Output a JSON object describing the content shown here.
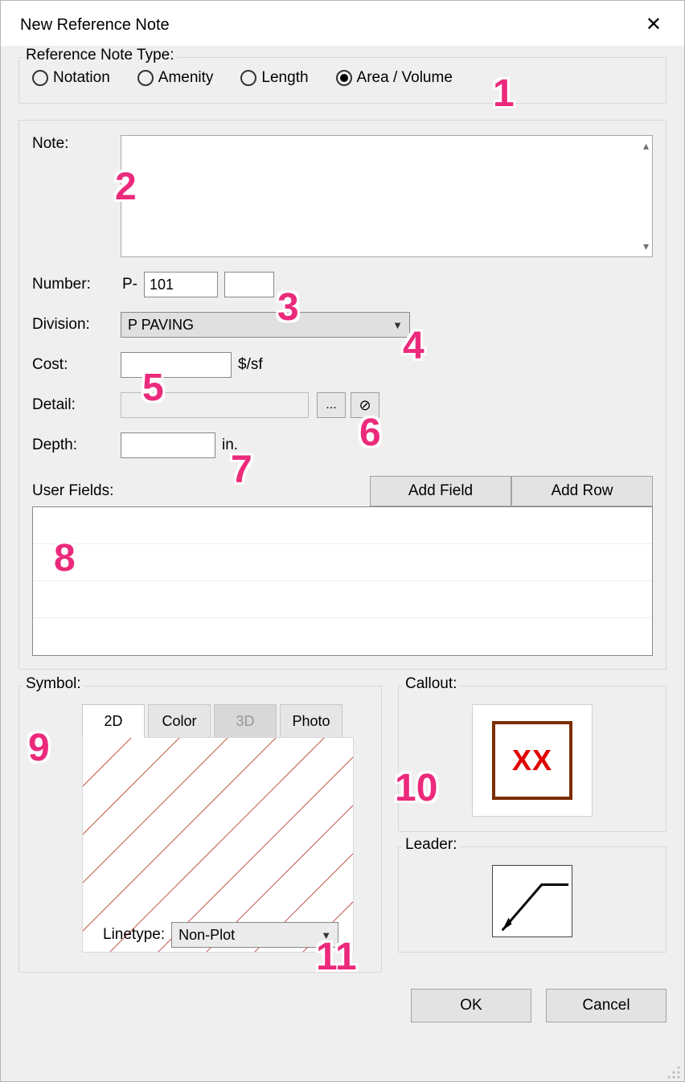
{
  "window": {
    "title": "New Reference Note"
  },
  "type_section": {
    "label": "Reference Note Type:",
    "options": {
      "notation": "Notation",
      "amenity": "Amenity",
      "length": "Length",
      "area_volume": "Area / Volume"
    },
    "selected": "area_volume"
  },
  "form": {
    "note_label": "Note:",
    "number_label": "Number:",
    "number_prefix": "P-",
    "number_value": "101",
    "number_suffix": "",
    "division_label": "Division:",
    "division_value": "P  PAVING",
    "cost_label": "Cost:",
    "cost_value": "",
    "cost_unit": "$/sf",
    "detail_label": "Detail:",
    "detail_value": "",
    "detail_browse": "...",
    "depth_label": "Depth:",
    "depth_value": "",
    "depth_unit": "in."
  },
  "user_fields": {
    "label": "User Fields:",
    "add_field": "Add Field",
    "add_row": "Add Row"
  },
  "symbol": {
    "label": "Symbol:",
    "tabs": {
      "t2d": "2D",
      "color": "Color",
      "t3d": "3D",
      "photo": "Photo"
    },
    "active_tab": "2D",
    "linetype_label": "Linetype:",
    "linetype_value": "Non-Plot"
  },
  "callout": {
    "label": "Callout:",
    "text": "XX"
  },
  "leader": {
    "label": "Leader:"
  },
  "footer": {
    "ok": "OK",
    "cancel": "Cancel"
  },
  "annotations": {
    "a1": "1",
    "a2": "2",
    "a3": "3",
    "a4": "4",
    "a5": "5",
    "a6": "6",
    "a7": "7",
    "a8": "8",
    "a9": "9",
    "a10": "10",
    "a11": "11"
  }
}
